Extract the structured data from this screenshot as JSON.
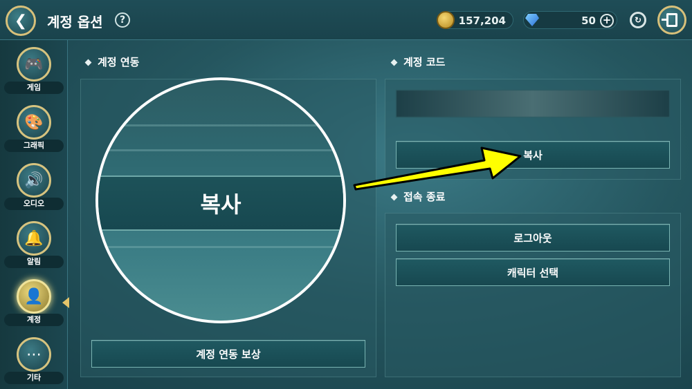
{
  "header": {
    "title": "계정 옵션",
    "help": "?",
    "gold": "157,204",
    "gems": "50"
  },
  "sidebar": {
    "items": [
      {
        "label": "게임",
        "icon": "gamepad-icon"
      },
      {
        "label": "그래픽",
        "icon": "palette-icon"
      },
      {
        "label": "오디오",
        "icon": "speaker-icon"
      },
      {
        "label": "알림",
        "icon": "bell-icon"
      },
      {
        "label": "계정",
        "icon": "user-icon"
      },
      {
        "label": "기타",
        "icon": "more-icon"
      }
    ],
    "active_index": 4
  },
  "sections": {
    "link_title": "계정 연동",
    "code_title": "계정 코드",
    "logout_title": "접속 종료"
  },
  "buttons": {
    "copy": "복사",
    "link_reward": "계정 연동 보상",
    "logout": "로그아웃",
    "character_select": "캐릭터 선택"
  },
  "colors": {
    "arrow": "#ffff00",
    "accent_gold": "#d7c07a"
  }
}
